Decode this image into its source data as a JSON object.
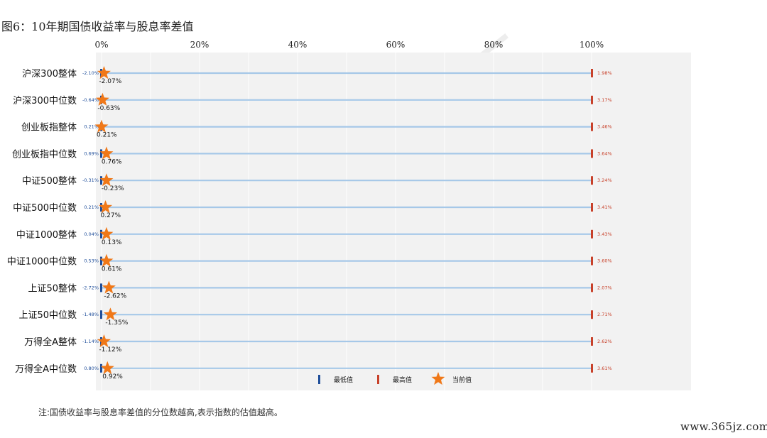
{
  "title": "图6：10年期国债收益率与股息率差值",
  "note": "注:国债收益率与股息率差值的分位数越高,表示指数的估值越高。",
  "site": "www.365jz.com",
  "watermark": "天风金工",
  "colors": {
    "line": "#a6c8e8",
    "min": "#1f4e9a",
    "max": "#c8412a",
    "star": "#f07818",
    "plot_bg": "#f2f2f2",
    "grid": "#ffffff"
  },
  "chart_data": {
    "type": "range-dot",
    "x_ticks": [
      "0%",
      "20%",
      "40%",
      "60%",
      "80%",
      "100%"
    ],
    "xlim": [
      0,
      100
    ],
    "legend": {
      "min_label": "最低值",
      "max_label": "最高值",
      "current_label": "当前值",
      "placement": "bottom-center"
    },
    "categories": [
      "沪深300整体",
      "沪深300中位数",
      "创业板指整体",
      "创业板指中位数",
      "中证500整体",
      "中证500中位数",
      "中证1000整体",
      "中证1000中位数",
      "上证50整体",
      "上证50中位数",
      "万得全A整体",
      "万得全A中位数"
    ],
    "min_labels": [
      "-2.10%",
      "-0.64%",
      "0.21%",
      "0.69%",
      "-0.31%",
      "0.21%",
      "0.04%",
      "0.53%",
      "-2.72%",
      "-1.48%",
      "-1.14%",
      "0.80%"
    ],
    "max_labels": [
      "1.98%",
      "3.17%",
      "3.46%",
      "3.64%",
      "3.24%",
      "3.41%",
      "3.43%",
      "3.60%",
      "2.07%",
      "2.71%",
      "2.62%",
      "3.61%"
    ],
    "current_labels": [
      "-2.07%",
      "-0.63%",
      "0.21%",
      "0.76%",
      "-0.23%",
      "0.27%",
      "0.13%",
      "0.61%",
      "-2.62%",
      "-1.35%",
      "-1.12%",
      "0.92%"
    ],
    "current_percentile": [
      0.5,
      0.2,
      0.0,
      1.0,
      1.0,
      0.8,
      1.0,
      1.0,
      1.5,
      1.8,
      0.5,
      1.2
    ]
  }
}
